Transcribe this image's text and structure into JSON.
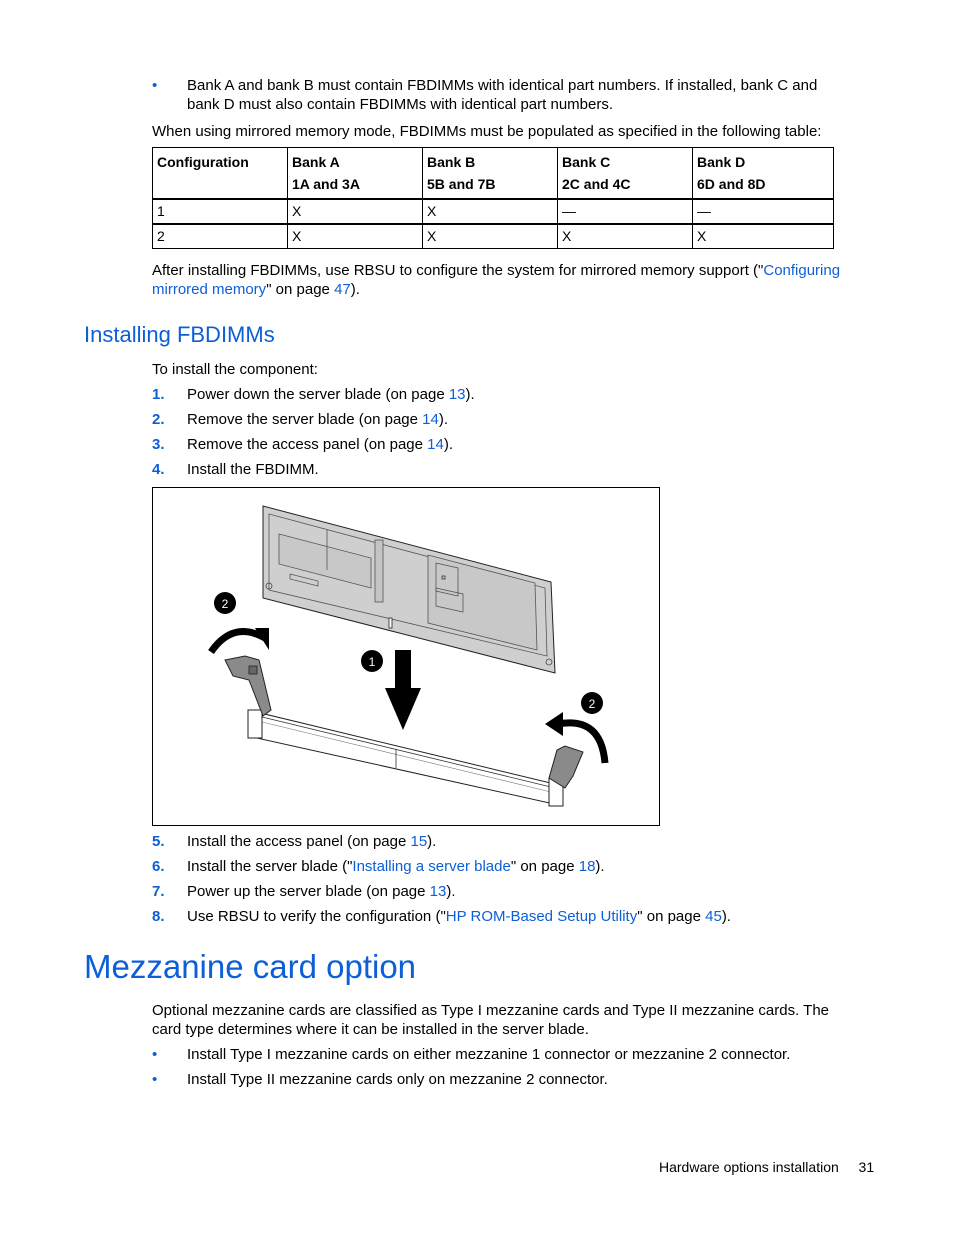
{
  "intro_bullet": "Bank A and bank B must contain FBDIMMs with identical part numbers. If installed, bank C and bank D must also contain FBDIMMs with identical part numbers.",
  "mirrored_intro": "When using mirrored memory mode, FBDIMMs must be populated as specified in the following table:",
  "table": {
    "headers": [
      {
        "title": "Configuration",
        "sub": ""
      },
      {
        "title": "Bank A",
        "sub": "1A and 3A"
      },
      {
        "title": "Bank B",
        "sub": "5B and 7B"
      },
      {
        "title": "Bank C",
        "sub": "2C and 4C"
      },
      {
        "title": "Bank D",
        "sub": "6D and 8D"
      }
    ],
    "rows": [
      [
        "1",
        "X",
        "X",
        "—",
        "—"
      ],
      [
        "2",
        "X",
        "X",
        "X",
        "X"
      ]
    ]
  },
  "after_install": {
    "text_before": "After installing FBDIMMs, use RBSU to configure the system for mirrored memory support (\"",
    "link": "Configuring mirrored memory",
    "text_mid": "\" on page ",
    "page": "47",
    "text_after": ")."
  },
  "section_heading": "Installing FBDIMMs",
  "steps_intro": "To install the component:",
  "steps": [
    {
      "num": "1.",
      "pre": "Power down the server blade (on page ",
      "link": "",
      "mid": "",
      "page": "13",
      "post": ")."
    },
    {
      "num": "2.",
      "pre": "Remove the server blade (on page ",
      "link": "",
      "mid": "",
      "page": "14",
      "post": ")."
    },
    {
      "num": "3.",
      "pre": "Remove the access panel (on page ",
      "link": "",
      "mid": "",
      "page": "14",
      "post": ")."
    },
    {
      "num": "4.",
      "pre": "Install the FBDIMM.",
      "link": "",
      "mid": "",
      "page": "",
      "post": ""
    },
    {
      "num": "5.",
      "pre": "Install the access panel (on page ",
      "link": "",
      "mid": "",
      "page": "15",
      "post": ")."
    },
    {
      "num": "6.",
      "pre": "Install the server blade (\"",
      "link": "Installing a server blade",
      "mid": "\" on page ",
      "page": "18",
      "post": ")."
    },
    {
      "num": "7.",
      "pre": "Power up the server blade (on page ",
      "link": "",
      "mid": "",
      "page": "13",
      "post": ")."
    },
    {
      "num": "8.",
      "pre": "Use RBSU to verify the configuration (\"",
      "link": "HP ROM-Based Setup Utility",
      "mid": "\" on page ",
      "page": "45",
      "post": ")."
    }
  ],
  "figure": {
    "callouts": [
      "1",
      "2",
      "2"
    ],
    "description": "FBDIMM being inserted into DIMM slot with latches opening"
  },
  "chapter_heading": "Mezzanine card option",
  "mezz_para": "Optional mezzanine cards are classified as Type I mezzanine cards and Type II mezzanine cards. The card type determines where it can be installed in the server blade.",
  "mezz_bullets": [
    "Install Type I mezzanine cards on either mezzanine 1 connector or mezzanine 2 connector.",
    "Install Type II mezzanine cards only on mezzanine 2 connector."
  ],
  "footer": {
    "section": "Hardware options installation",
    "page_number": "31"
  },
  "colors": {
    "accent": "#0d5fd8"
  }
}
